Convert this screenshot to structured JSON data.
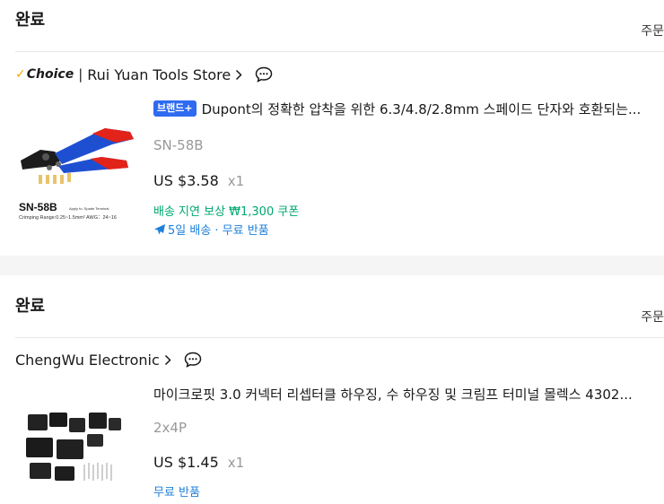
{
  "orders": [
    {
      "status": "완료",
      "order_link": "주문",
      "store": {
        "choice_label": "Choice",
        "separator": "|",
        "name": "Rui Yuan Tools Store"
      },
      "item": {
        "brand_badge": "브랜드+",
        "title": "Dupont의 정확한 압착을 위한 6.3/4.8/2.8mm 스페이드 단자와 호환되는...",
        "variant": "SN-58B",
        "price": "US $3.58",
        "qty": "x1",
        "coupon": "배송 지연 보상 ₩1,300 쿠폰",
        "shipping": "5일 배송 · 무료 반품",
        "thumb": {
          "model": "SN-58B",
          "apply": "Apply to:  Spade Terminal",
          "range": "Crimping Range:0.25~1.5mm²  AWG：24~16"
        }
      }
    },
    {
      "status": "완료",
      "order_link": "주문",
      "store": {
        "name": "ChengWu Electronic"
      },
      "item": {
        "title": "마이크로핏 3.0 커넥터 리셉터클 하우징, 수 하우징 및 크림프 터미널 몰렉스 4302...",
        "variant": "2x4P",
        "price": "US $1.45",
        "qty": "x1",
        "shipping": "무료 반품"
      }
    }
  ],
  "colors": {
    "brand_badge": "#2e6bf0",
    "coupon_green": "#00a870",
    "shipping_blue": "#1d7fdb",
    "choice_gold": "#f7a600",
    "separator_band": "#f5f5f5"
  }
}
